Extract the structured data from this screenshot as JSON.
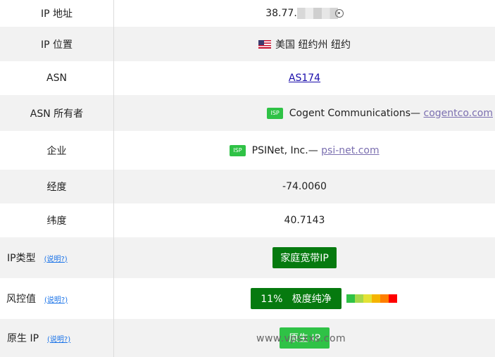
{
  "rows": {
    "ip": {
      "label": "IP 地址",
      "value": "38.77."
    },
    "location": {
      "label": "IP 位置",
      "flag_icon": "us-flag-icon",
      "value": "美国 纽约州 纽约"
    },
    "asn": {
      "label": "ASN",
      "value": "AS174"
    },
    "asn_owner": {
      "label": "ASN 所有者",
      "badge": "ISP",
      "name": "Cogent Communications— ",
      "domain": "cogentco.com"
    },
    "company": {
      "label": "企业",
      "badge": "ISP",
      "name": "PSINet, Inc.— ",
      "domain": "psi-net.com"
    },
    "longitude": {
      "label": "经度",
      "value": "-74.0060"
    },
    "latitude": {
      "label": "纬度",
      "value": "40.7143"
    },
    "ip_type": {
      "label": "IP类型",
      "explain": "(说明?)",
      "value": "家庭宽带IP"
    },
    "risk": {
      "label": "风控值",
      "explain": "(说明?)",
      "value": "11%   极度纯净",
      "scale_colors": [
        "#2fc246",
        "#a6d84a",
        "#e3e236",
        "#f5b400",
        "#ff7f00",
        "#ff0000"
      ]
    },
    "native": {
      "label": "原生 IP",
      "explain": "(说明?)",
      "value": "原生 IP"
    }
  },
  "watermark": "www.vpsxxs.com"
}
